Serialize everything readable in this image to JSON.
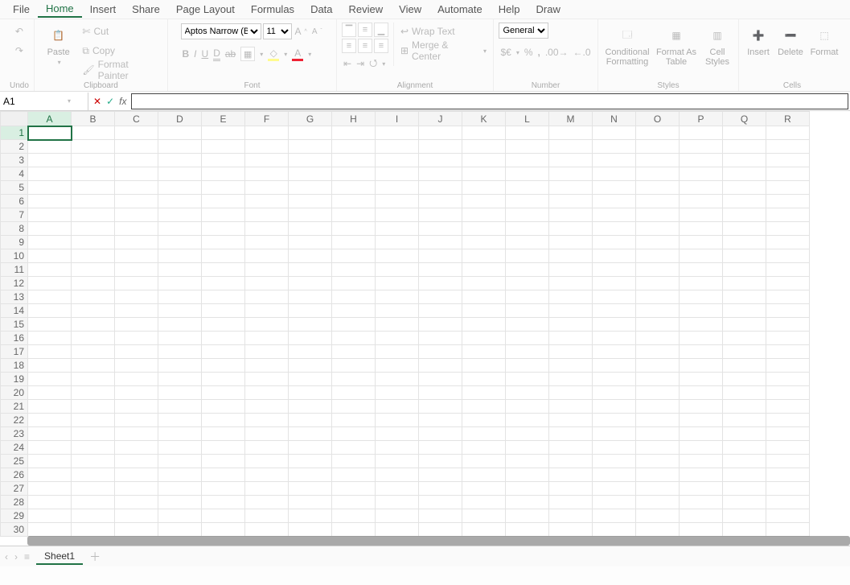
{
  "menu": {
    "items": [
      "File",
      "Home",
      "Insert",
      "Share",
      "Page Layout",
      "Formulas",
      "Data",
      "Review",
      "View",
      "Automate",
      "Help",
      "Draw"
    ],
    "active": "Home"
  },
  "ribbon": {
    "undo": {
      "group": "Undo"
    },
    "clipboard": {
      "paste": "Paste",
      "cut": "Cut",
      "copy": "Copy",
      "format_painter": "Format Painter",
      "group": "Clipboard"
    },
    "font": {
      "font_name": "Aptos Narrow (Body)",
      "font_size": "11",
      "group": "Font"
    },
    "alignment": {
      "wrap": "Wrap Text",
      "merge": "Merge & Center",
      "group": "Alignment"
    },
    "number": {
      "format": "General",
      "currency": "$€",
      "percent": "%",
      "comma": ",",
      "inc": ".00",
      "dec": ".0",
      "group": "Number"
    },
    "styles": {
      "cond": "Conditional Formatting",
      "fat": "Format As Table",
      "cell": "Cell Styles",
      "group": "Styles"
    },
    "cells": {
      "insert": "Insert",
      "delete": "Delete",
      "format": "Format",
      "group": "Cells"
    }
  },
  "formula_bar": {
    "name_box": "A1",
    "cancel": "✕",
    "confirm": "✓",
    "fx": "fx",
    "value": ""
  },
  "grid": {
    "columns": [
      "A",
      "B",
      "C",
      "D",
      "E",
      "F",
      "G",
      "H",
      "I",
      "J",
      "K",
      "L",
      "M",
      "N",
      "O",
      "P",
      "Q",
      "R"
    ],
    "rows": [
      1,
      2,
      3,
      4,
      5,
      6,
      7,
      8,
      9,
      10,
      11,
      12,
      13,
      14,
      15,
      16,
      17,
      18,
      19,
      20,
      21,
      22,
      23,
      24,
      25,
      26,
      27,
      28,
      29,
      30
    ],
    "selected": {
      "col": "A",
      "row": 1
    },
    "cells": {}
  },
  "sheets": {
    "active": "Sheet1",
    "tabs": [
      "Sheet1"
    ]
  }
}
